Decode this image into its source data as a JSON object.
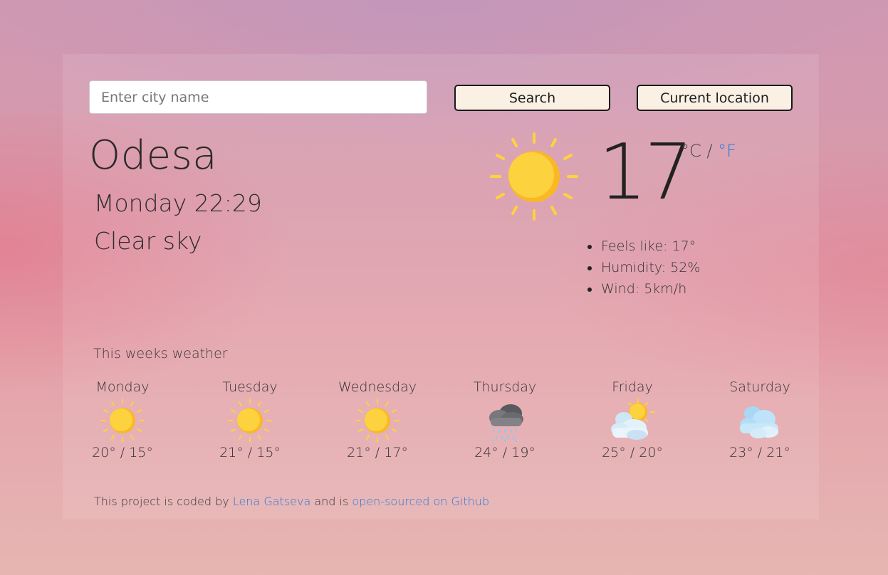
{
  "search": {
    "placeholder": "Enter city name",
    "value": ""
  },
  "buttons": {
    "search": "Search",
    "current_location": "Current location"
  },
  "current": {
    "city": "Odesa",
    "datetime": "Monday 22:29",
    "description": "Clear sky",
    "temperature": "17",
    "unit_c": "°C",
    "unit_sep": " / ",
    "unit_f": "°F",
    "icon": "sun-icon",
    "details": [
      "Feels like: 17°",
      "Humidity: 52%",
      "Wind: 5km/h"
    ]
  },
  "forecast": {
    "title": "This weeks weather",
    "days": [
      {
        "name": "Monday",
        "temp": "20° / 15°",
        "icon": "sun-icon"
      },
      {
        "name": "Tuesday",
        "temp": "21° / 15°",
        "icon": "sun-icon"
      },
      {
        "name": "Wednesday",
        "temp": "21° / 17°",
        "icon": "sun-icon"
      },
      {
        "name": "Thursday",
        "temp": "24° / 19°",
        "icon": "rain-cloud-icon"
      },
      {
        "name": "Friday",
        "temp": "25° / 20°",
        "icon": "partly-cloudy-icon"
      },
      {
        "name": "Saturday",
        "temp": "23° / 21°",
        "icon": "clouds-icon"
      }
    ]
  },
  "footer": {
    "prefix": "This project is coded by ",
    "author": "Lena Gatseva",
    "middle": " and is ",
    "repo": "open-sourced on Github"
  },
  "colors": {
    "accent_link": "#2f78d6",
    "button_bg": "#faf0e4",
    "sun": "#fdd23f",
    "sun_shadow": "#f9b824"
  }
}
